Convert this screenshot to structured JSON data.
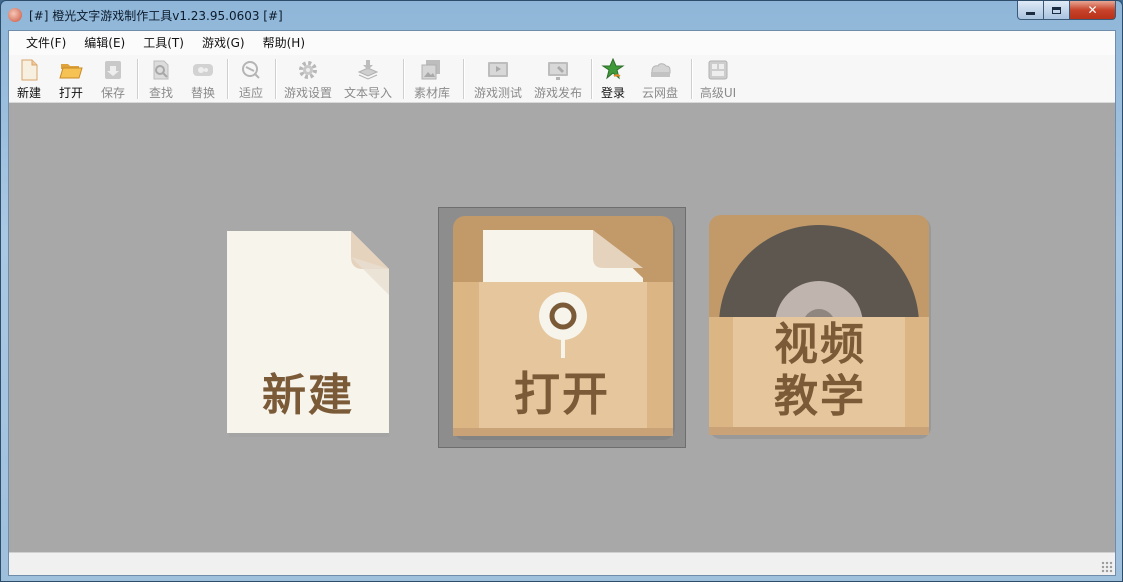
{
  "window": {
    "title": "[#] 橙光文字游戏制作工具v1.23.95.0603  [#]",
    "controls": {
      "minimize": "",
      "maximize": "",
      "close": "✕"
    }
  },
  "menu": [
    {
      "label": "文件(F)"
    },
    {
      "label": "编辑(E)"
    },
    {
      "label": "工具(T)"
    },
    {
      "label": "游戏(G)"
    },
    {
      "label": "帮助(H)"
    }
  ],
  "toolbar": [
    {
      "label": "新建",
      "icon": "new-file-icon",
      "enabled": true
    },
    {
      "label": "打开",
      "icon": "open-folder-icon",
      "enabled": true
    },
    {
      "label": "保存",
      "icon": "save-icon",
      "enabled": false
    },
    {
      "label": "查找",
      "icon": "find-icon",
      "enabled": false
    },
    {
      "label": "替换",
      "icon": "replace-icon",
      "enabled": false
    },
    {
      "label": "适应",
      "icon": "fit-icon",
      "enabled": false
    },
    {
      "label": "游戏设置",
      "icon": "gear-icon",
      "enabled": false
    },
    {
      "label": "文本导入",
      "icon": "text-import-icon",
      "enabled": false
    },
    {
      "label": "素材库",
      "icon": "asset-library-icon",
      "enabled": false
    },
    {
      "label": "游戏测试",
      "icon": "game-test-icon",
      "enabled": false
    },
    {
      "label": "游戏发布",
      "icon": "game-publish-icon",
      "enabled": false
    },
    {
      "label": "登录",
      "icon": "login-star-icon",
      "enabled": true
    },
    {
      "label": "云网盘",
      "icon": "cloud-drive-icon",
      "enabled": false
    },
    {
      "label": "高级UI",
      "icon": "advanced-ui-icon",
      "enabled": false
    }
  ],
  "start_cards": {
    "new": {
      "label": "新建"
    },
    "open": {
      "label": "打开"
    },
    "tutorial": {
      "line1": "视频",
      "line2": "教学"
    }
  },
  "colors": {
    "workspace": "#a8a8a8",
    "card_paper": "#f7f4ec",
    "card_folder": "#e6c69c",
    "card_folder_dark": "#c39b6b",
    "card_text": "#7a5a37",
    "disc": "#5e574f"
  }
}
